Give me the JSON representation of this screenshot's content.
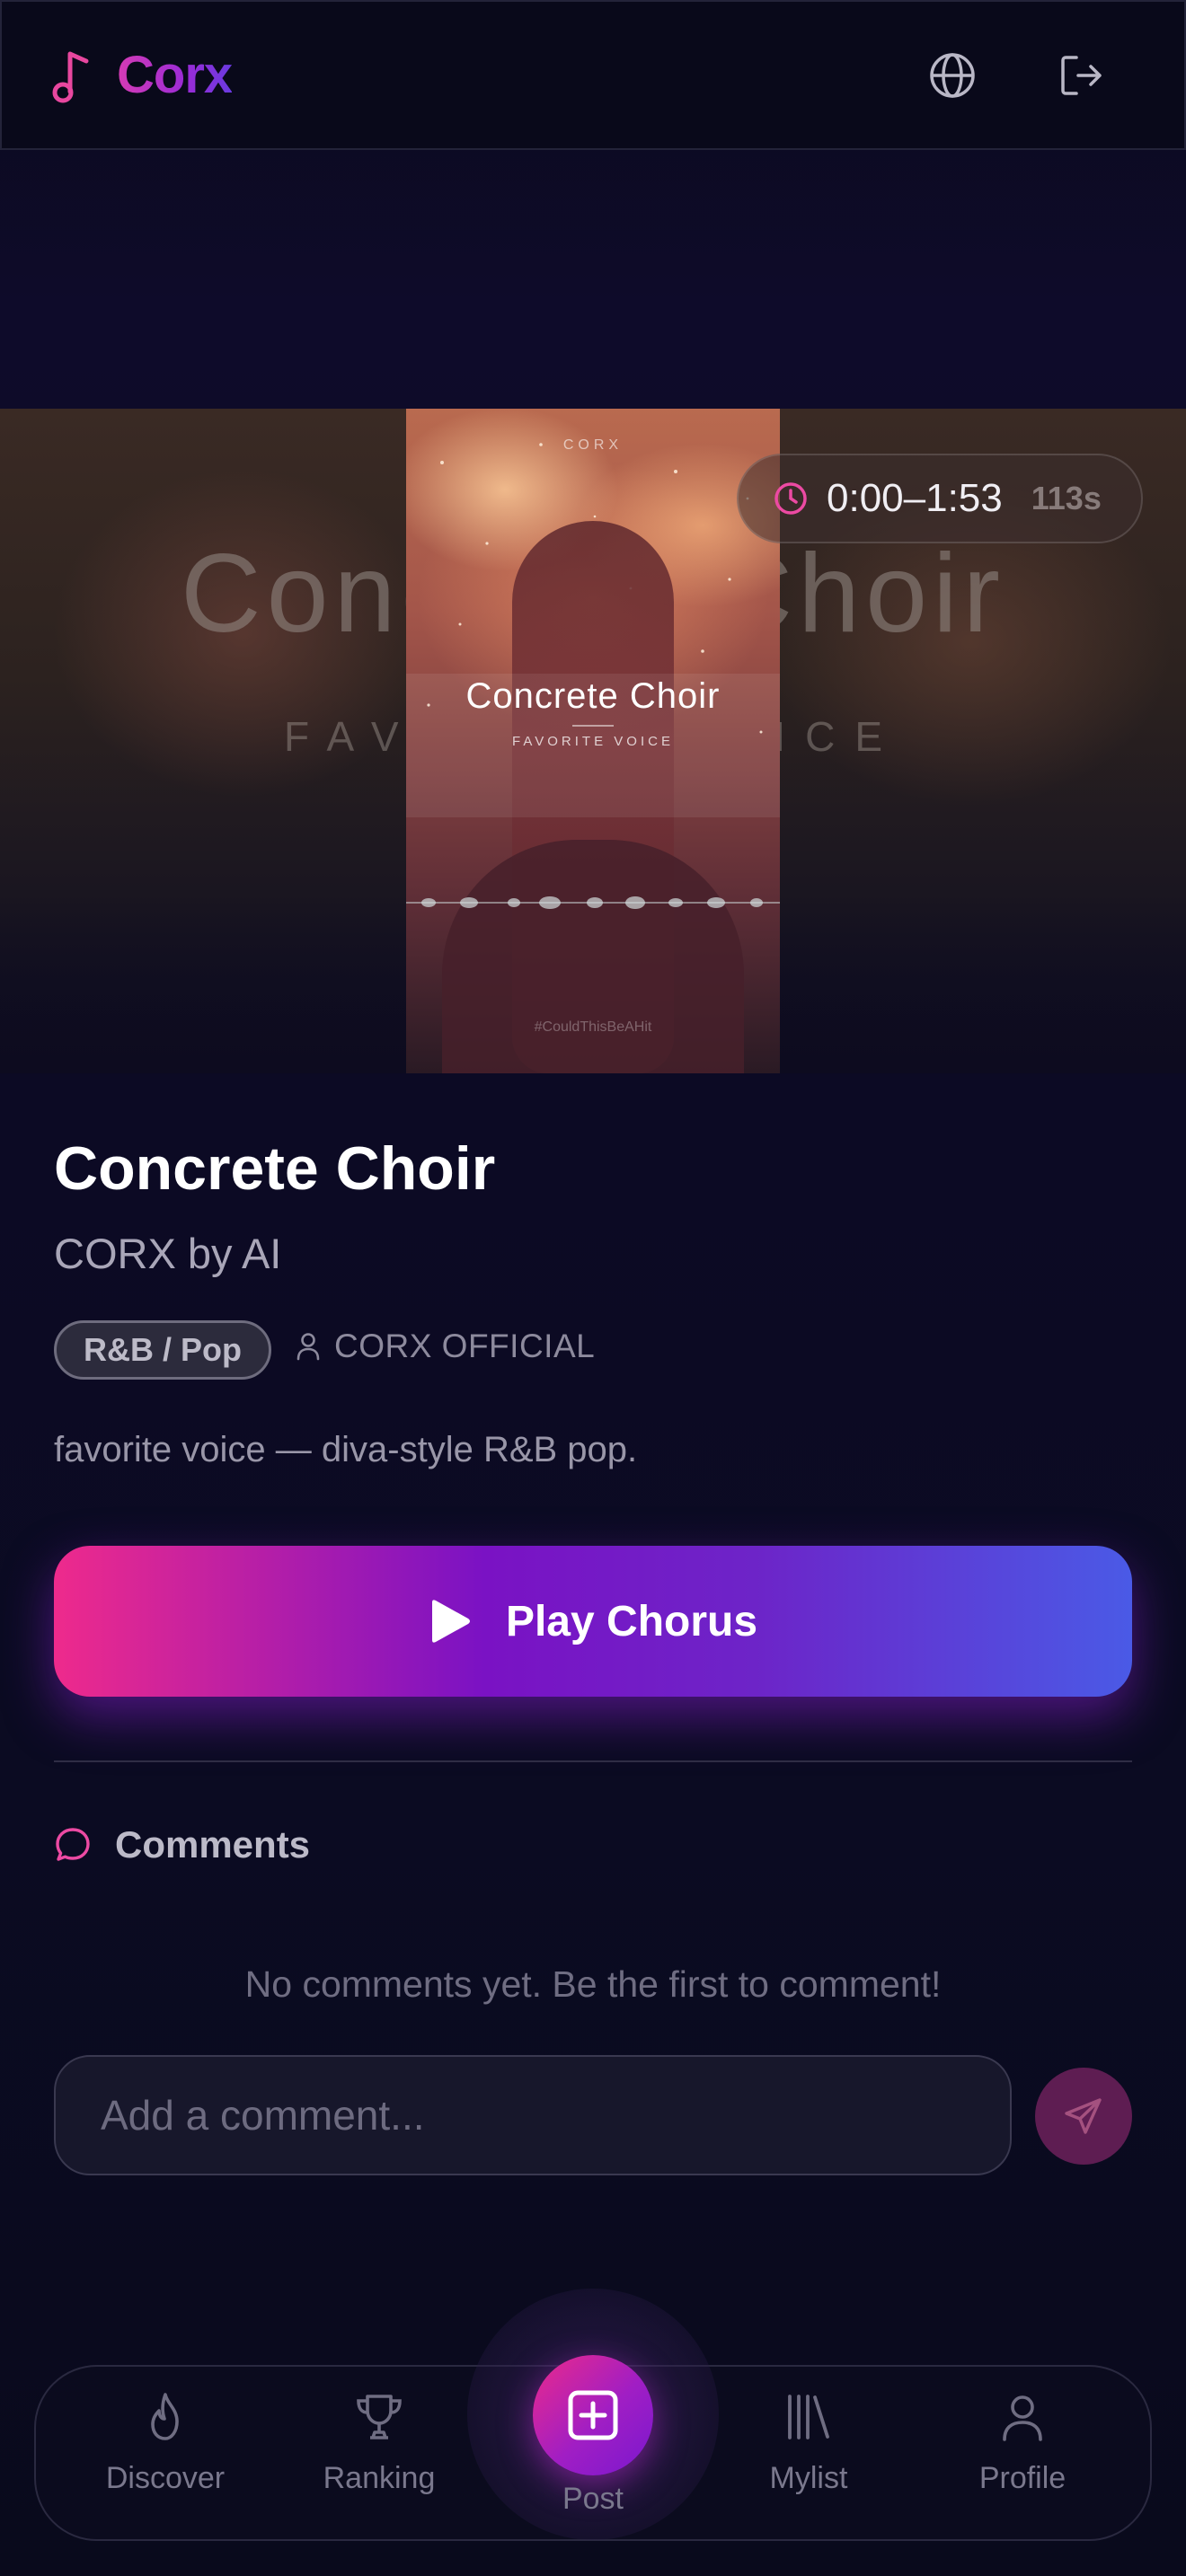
{
  "app": {
    "name": "Corx"
  },
  "header": {
    "globe_icon": "globe-icon",
    "logout_icon": "logout-icon"
  },
  "cover": {
    "brand": "CORX",
    "title": "Concrete Choir",
    "subtitle": "FAVORITE VOICE",
    "hashtag": "#CouldThisBeAHit"
  },
  "hero_background": {
    "title": "Concrete Choir",
    "subtitle": "FAVORITE VOICE"
  },
  "chorus": {
    "range": "0:00–1:53",
    "seconds": "113s"
  },
  "song": {
    "title": "Concrete Choir",
    "artist": "CORX by AI",
    "genre": "R&B / Pop",
    "creator": "CORX OFFICIAL",
    "description": "favorite voice — diva-style R&B pop."
  },
  "play_button": {
    "label": "Play Chorus"
  },
  "comments": {
    "title": "Comments",
    "empty_text": "No comments yet. Be the first to comment!",
    "input_placeholder": "Add a comment...",
    "input_value": ""
  },
  "nav": {
    "items": [
      {
        "label": "Discover",
        "icon": "flame-icon"
      },
      {
        "label": "Ranking",
        "icon": "trophy-icon"
      },
      {
        "label": "Post",
        "icon": "plus-square-icon"
      },
      {
        "label": "Mylist",
        "icon": "library-icon"
      },
      {
        "label": "Profile",
        "icon": "user-icon"
      }
    ]
  },
  "colors": {
    "accent_pink": "#ee2a8c",
    "accent_purple": "#7a12c4",
    "accent_blue": "#4a5ae6",
    "background": "#0c0a24"
  }
}
